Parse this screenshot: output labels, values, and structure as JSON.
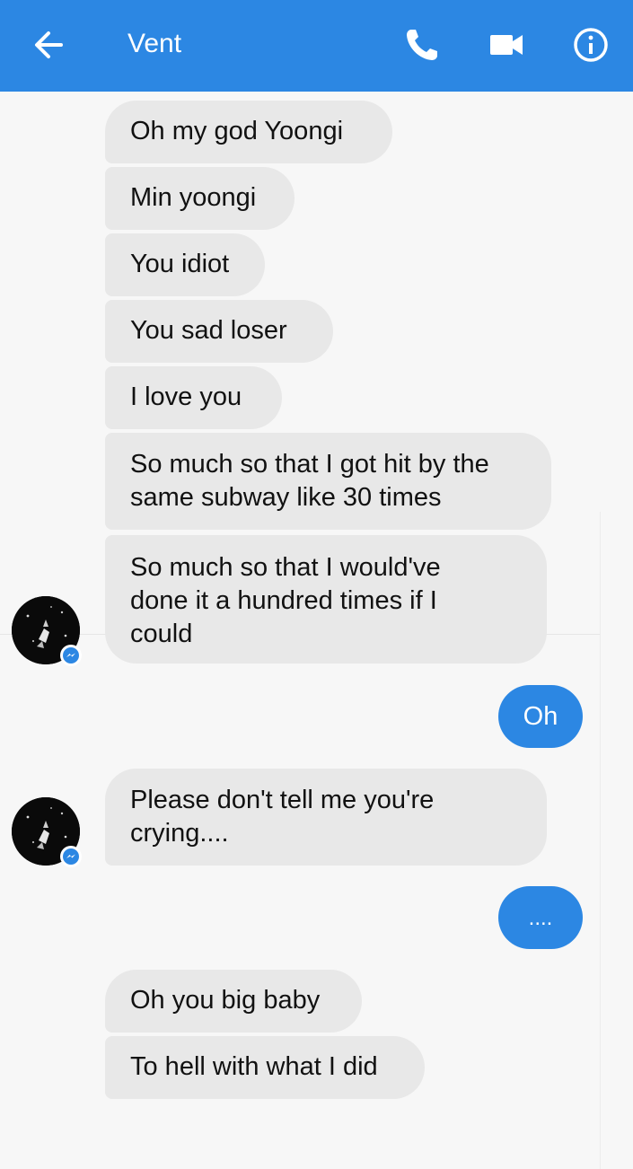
{
  "header": {
    "title": "Vent",
    "back_icon": "arrow-left-icon",
    "call_icon": "phone-icon",
    "video_icon": "video-camera-icon",
    "info_icon": "info-icon",
    "color": "#2c87e3"
  },
  "messages": [
    {
      "text": "Oh my god Yoongi",
      "direction": "incoming"
    },
    {
      "text": "Min yoongi",
      "direction": "incoming"
    },
    {
      "text": "You idiot",
      "direction": "incoming"
    },
    {
      "text": "You sad loser",
      "direction": "incoming"
    },
    {
      "text": "I love you",
      "direction": "incoming"
    },
    {
      "text": "So much so that I got hit by the same subway like 30 times",
      "direction": "incoming"
    },
    {
      "text": "So much so that I would've done it a hundred times if I could",
      "direction": "incoming"
    },
    {
      "text": "Oh",
      "direction": "outgoing"
    },
    {
      "text": "Please don't tell me you're crying....",
      "direction": "incoming"
    },
    {
      "text": "....",
      "direction": "outgoing"
    },
    {
      "text": "Oh you big baby",
      "direction": "incoming"
    },
    {
      "text": "To hell with what I did",
      "direction": "incoming"
    }
  ],
  "colors": {
    "incoming_bubble": "#e8e8e8",
    "outgoing_bubble": "#2c87e3",
    "background": "#f7f7f7"
  }
}
